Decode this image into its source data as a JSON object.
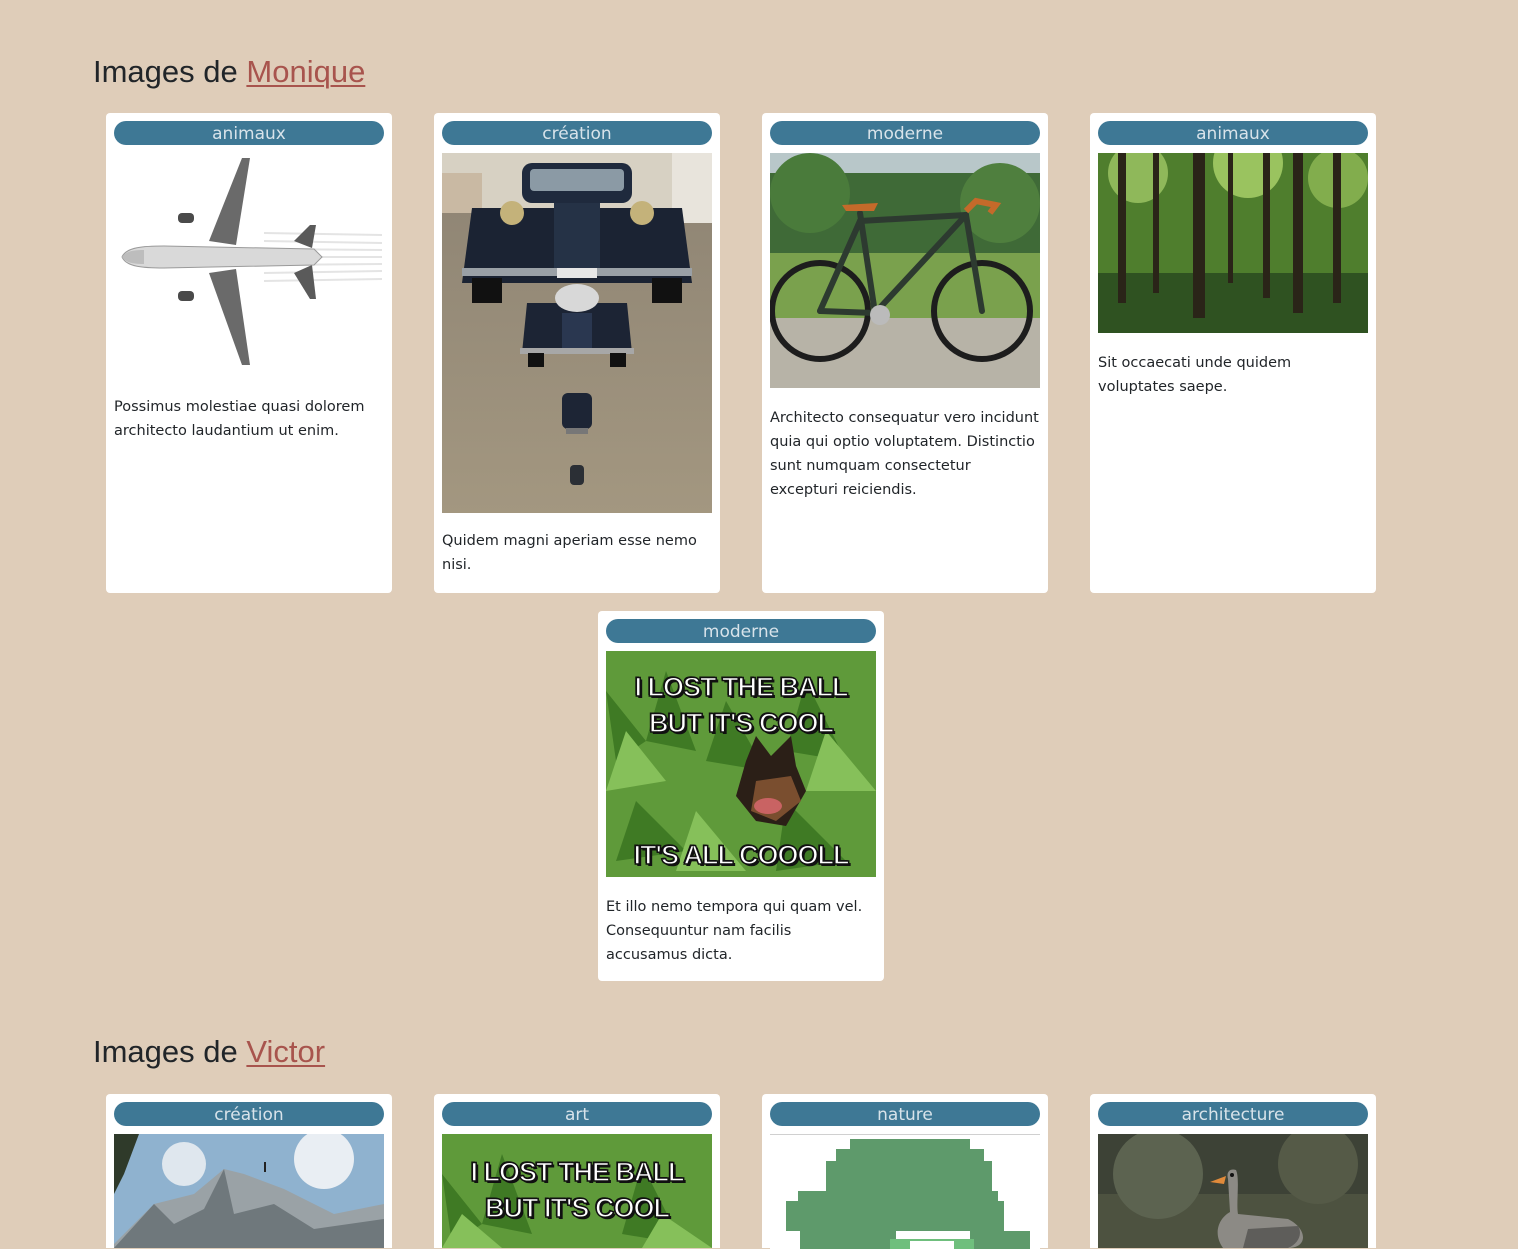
{
  "sections": [
    {
      "title_prefix": "Images de",
      "user_name": "Monique",
      "cards": [
        {
          "category": "animaux",
          "image": "airplane",
          "description": "Possimus molestiae quasi dolorem architecto laudantium ut enim."
        },
        {
          "category": "création",
          "image": "vintage-car",
          "description": "Quidem magni aperiam esse nemo nisi."
        },
        {
          "category": "moderne",
          "image": "bicycle",
          "description": "Architecto consequatur vero incidunt quia qui optio voluptatem. Distinctio sunt numquam consectetur excepturi reiciendis."
        },
        {
          "category": "animaux",
          "image": "forest",
          "description": "Sit occaecati unde quidem voluptates saepe."
        },
        {
          "category": "moderne",
          "image": "dog-meme",
          "description": "Et illo nemo tempora qui quam vel. Consequuntur nam facilis accusamus dicta.",
          "meme_top": [
            "I LOST THE BALL",
            "BUT IT'S COOL"
          ],
          "meme_bottom": "IT'S ALL COOOLL"
        }
      ]
    },
    {
      "title_prefix": "Images de",
      "user_name": "Victor",
      "cards": [
        {
          "category": "création",
          "image": "mountain"
        },
        {
          "category": "art",
          "image": "dog-meme",
          "meme_top": [
            "I LOST THE BALL",
            "BUT IT'S COOL"
          ]
        },
        {
          "category": "nature",
          "image": "pixel-art"
        },
        {
          "category": "architecture",
          "image": "goose"
        }
      ]
    }
  ]
}
